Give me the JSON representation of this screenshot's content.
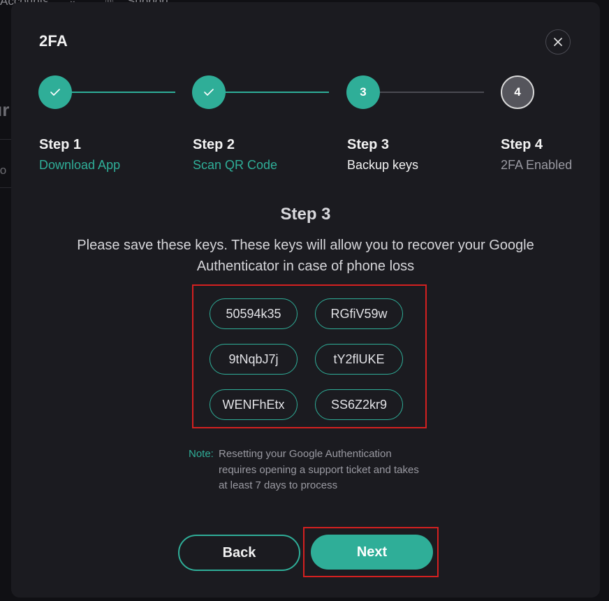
{
  "background": {
    "accounts_label": "Accounts",
    "support_label": "Support"
  },
  "modal": {
    "title": "2FA",
    "close_icon": "close-icon"
  },
  "stepper": {
    "steps": [
      {
        "number": "1",
        "name": "Step 1",
        "label": "Download App",
        "state": "completed"
      },
      {
        "number": "2",
        "name": "Step 2",
        "label": "Scan QR Code",
        "state": "completed"
      },
      {
        "number": "3",
        "name": "Step 3",
        "label": "Backup keys",
        "state": "active"
      },
      {
        "number": "4",
        "name": "Step 4",
        "label": "2FA Enabled",
        "state": "pending"
      }
    ]
  },
  "content": {
    "heading": "Step 3",
    "description": "Please save these keys. These keys will allow you to recover your Google Authenticator in case of phone loss",
    "keys": [
      "50594k35",
      "RGfiV59w",
      "9tNqbJ7j",
      "tY2flUKE",
      "WENFhEtx",
      "SS6Z2kr9"
    ],
    "note_label": "Note:",
    "note_text": "Resetting your Google Authentication requires opening a support ticket and takes at least 7 days to process"
  },
  "actions": {
    "back_label": "Back",
    "next_label": "Next"
  },
  "colors": {
    "accent": "#2fae98",
    "highlight": "#d42020",
    "modal_bg": "#1b1b20",
    "page_bg": "#101014"
  }
}
